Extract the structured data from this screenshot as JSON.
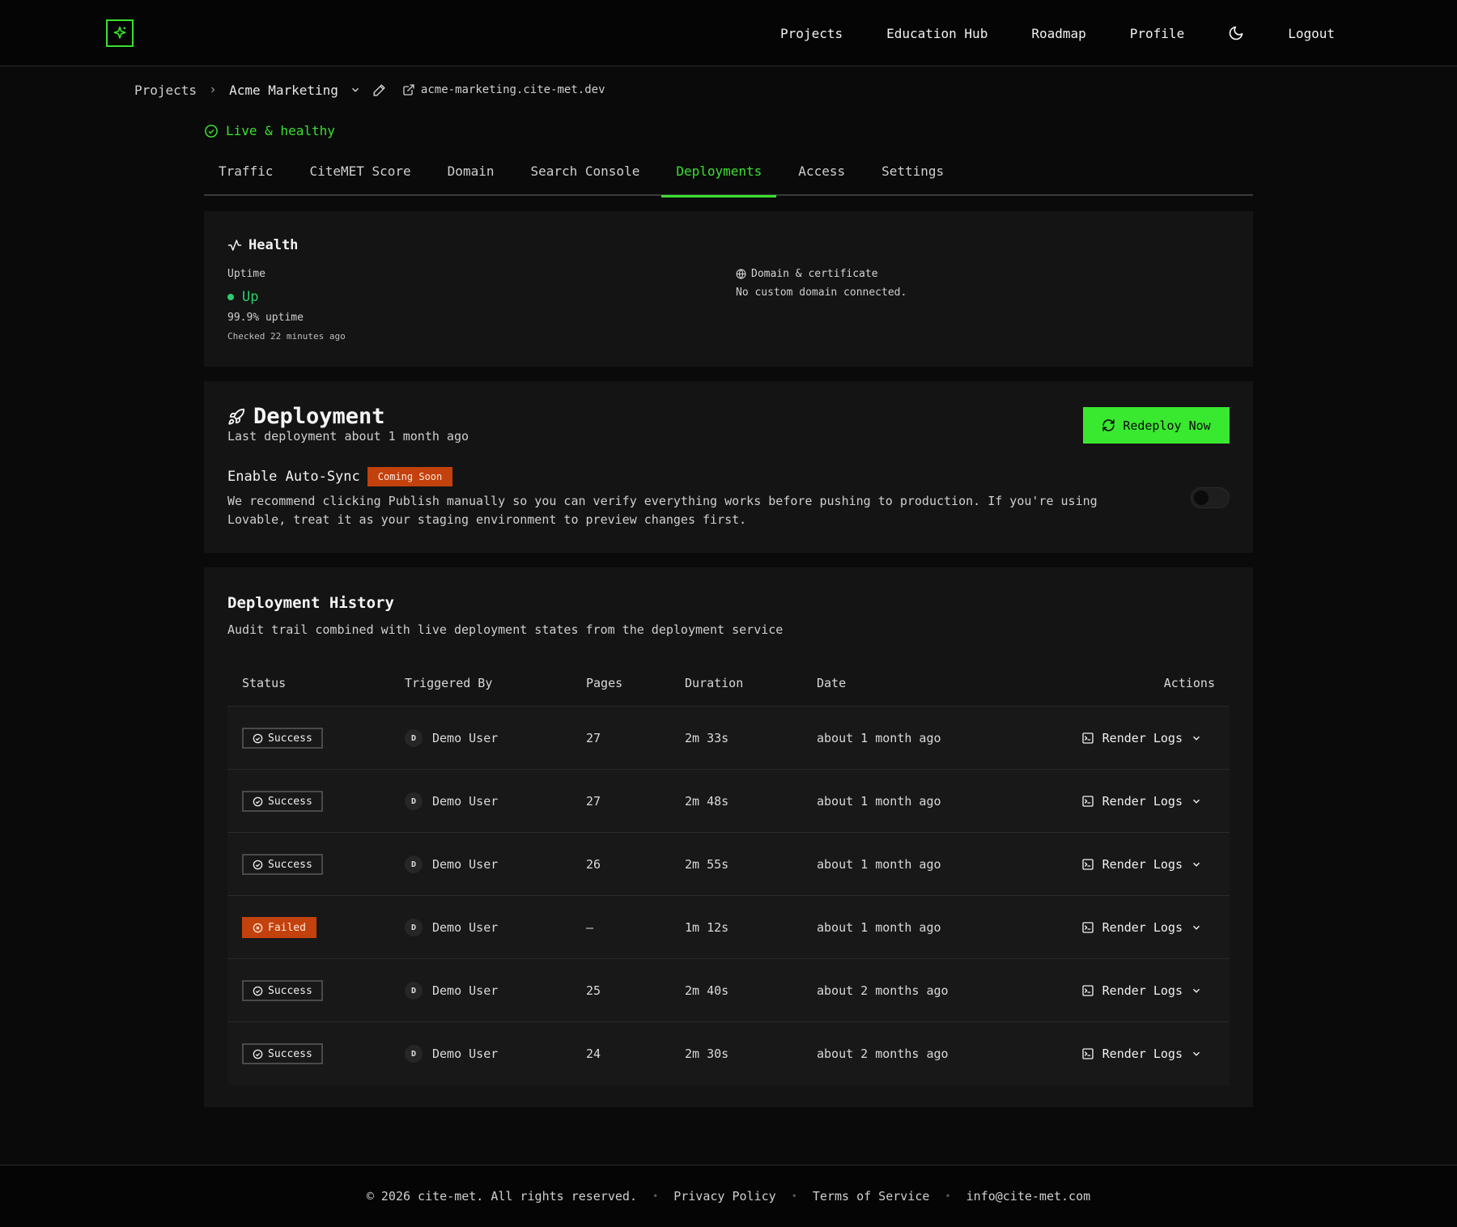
{
  "nav": {
    "links": [
      "Projects",
      "Education Hub",
      "Roadmap",
      "Profile"
    ],
    "logout": "Logout",
    "logo_icon": "sparkle-icon",
    "theme_icon": "moon-icon",
    "accent": "#39e02f"
  },
  "breadcrumb": {
    "root": "Projects",
    "project": "Acme Marketing",
    "url": "acme-marketing.cite-met.dev"
  },
  "status": {
    "text": "Live & healthy"
  },
  "tabs": [
    {
      "label": "Traffic"
    },
    {
      "label": "CiteMET Score"
    },
    {
      "label": "Domain"
    },
    {
      "label": "Search Console"
    },
    {
      "label": "Deployments",
      "active": true
    },
    {
      "label": "Access"
    },
    {
      "label": "Settings"
    }
  ],
  "health": {
    "title": "Health",
    "uptime_label": "Uptime",
    "uptime_state": "Up",
    "uptime_pct": "99.9% uptime",
    "checked": "Checked 22 minutes ago",
    "domain_label": "Domain & certificate",
    "domain_value": "No custom domain connected."
  },
  "deployment": {
    "title": "Deployment",
    "subtitle": "Last deployment about 1 month ago",
    "redeploy": "Redeploy Now",
    "autosync_label": "Enable Auto-Sync",
    "autosync_badge": "Coming Soon",
    "autosync_desc": "We recommend clicking Publish manually so you can verify everything works before pushing to production. If you're using Lovable, treat it as your staging environment to preview changes first.",
    "autosync_enabled": false
  },
  "history": {
    "title": "Deployment History",
    "subtitle": "Audit trail combined with live deployment states from the deployment service",
    "columns": {
      "status": "Status",
      "triggered_by": "Triggered By",
      "pages": "Pages",
      "duration": "Duration",
      "date": "Date",
      "actions": "Actions"
    },
    "rows": [
      {
        "status": "Success",
        "kind": "success",
        "avatar": "D",
        "user": "Demo User",
        "pages": "27",
        "duration": "2m 33s",
        "date": "about 1 month ago",
        "action": "Render Logs"
      },
      {
        "status": "Success",
        "kind": "success",
        "avatar": "D",
        "user": "Demo User",
        "pages": "27",
        "duration": "2m 48s",
        "date": "about 1 month ago",
        "action": "Render Logs"
      },
      {
        "status": "Success",
        "kind": "success",
        "avatar": "D",
        "user": "Demo User",
        "pages": "26",
        "duration": "2m 55s",
        "date": "about 1 month ago",
        "action": "Render Logs"
      },
      {
        "status": "Failed",
        "kind": "failed",
        "avatar": "D",
        "user": "Demo User",
        "pages": "—",
        "duration": "1m 12s",
        "date": "about 1 month ago",
        "action": "Render Logs"
      },
      {
        "status": "Success",
        "kind": "success",
        "avatar": "D",
        "user": "Demo User",
        "pages": "25",
        "duration": "2m 40s",
        "date": "about 2 months ago",
        "action": "Render Logs"
      },
      {
        "status": "Success",
        "kind": "success",
        "avatar": "D",
        "user": "Demo User",
        "pages": "24",
        "duration": "2m 30s",
        "date": "about 2 months ago",
        "action": "Render Logs"
      }
    ]
  },
  "footer": {
    "copyright": "© 2026 cite-met. All rights reserved.",
    "privacy": "Privacy Policy",
    "terms": "Terms of Service",
    "email": "info@cite-met.com"
  }
}
